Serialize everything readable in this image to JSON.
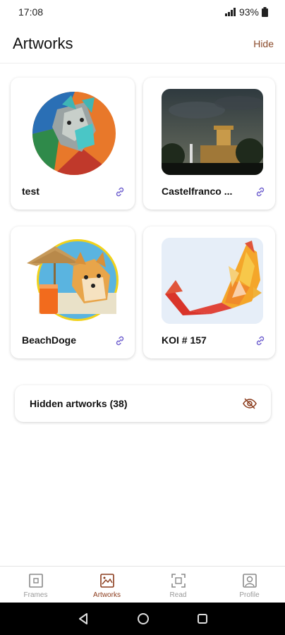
{
  "status_bar": {
    "time": "17:08",
    "battery": "93%"
  },
  "header": {
    "title": "Artworks",
    "hide_label": "Hide"
  },
  "artworks": [
    {
      "label": "test",
      "icon": "dog-cubist-art-icon"
    },
    {
      "label": "Castelfranco ...",
      "icon": "castle-night-photo-icon"
    },
    {
      "label": "BeachDoge",
      "icon": "beach-doge-art-icon"
    },
    {
      "label": "KOI # 157",
      "icon": "koi-fish-art-icon"
    }
  ],
  "hidden_section": {
    "label": "Hidden artworks (38)",
    "icon": "eye-off-icon"
  },
  "bottom_nav": [
    {
      "label": "Frames",
      "icon": "frame-icon",
      "active": false
    },
    {
      "label": "Artworks",
      "icon": "image-icon",
      "active": true
    },
    {
      "label": "Read",
      "icon": "scan-icon",
      "active": false
    },
    {
      "label": "Profile",
      "icon": "profile-icon",
      "active": false
    }
  ],
  "colors": {
    "accent": "#8a3a1a",
    "link_icon": "#6a5acd",
    "inactive": "#999999"
  }
}
